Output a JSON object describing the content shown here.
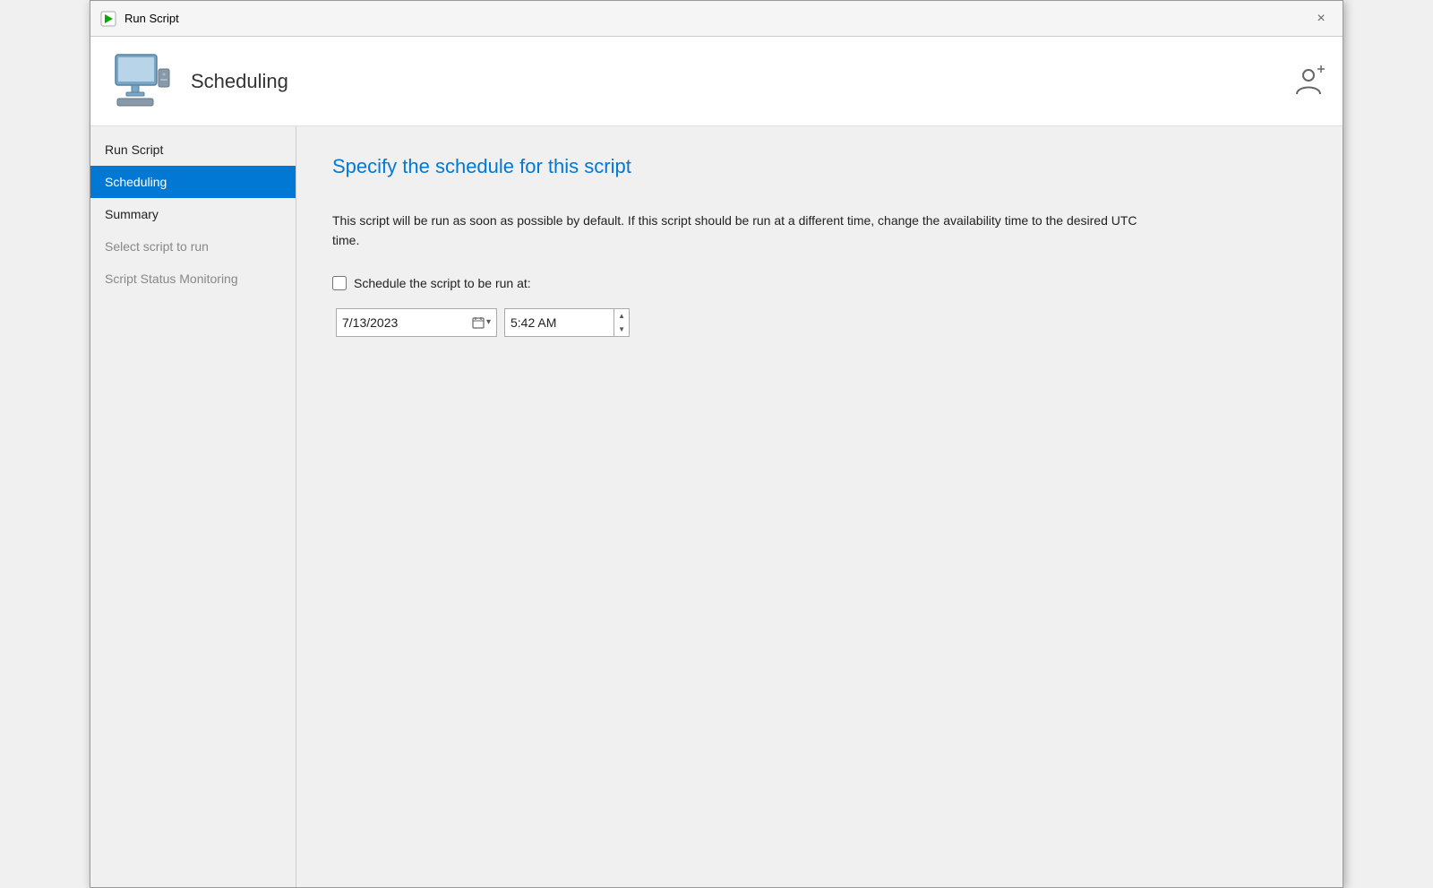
{
  "titlebar": {
    "title": "Run Script",
    "close_label": "×"
  },
  "header": {
    "title": "Scheduling"
  },
  "sidebar": {
    "items": [
      {
        "id": "run-script",
        "label": "Run Script",
        "state": "normal"
      },
      {
        "id": "scheduling",
        "label": "Scheduling",
        "state": "active"
      },
      {
        "id": "summary",
        "label": "Summary",
        "state": "normal"
      },
      {
        "id": "select-script",
        "label": "Select script to run",
        "state": "disabled"
      },
      {
        "id": "script-status",
        "label": "Script Status Monitoring",
        "state": "disabled"
      }
    ]
  },
  "content": {
    "heading": "Specify the schedule for this script",
    "description": "This script will be run as soon as possible by default. If this script should be run at a different time, change the availability time to the desired UTC time.",
    "checkbox_label": "Schedule the script to be run at:",
    "date_value": "7/13/2023",
    "time_value": "5:42 AM"
  }
}
